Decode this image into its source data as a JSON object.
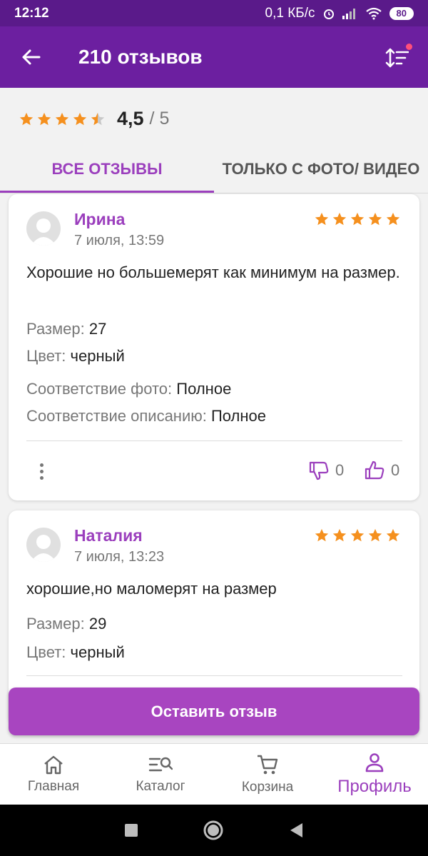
{
  "status_bar": {
    "time": "12:12",
    "network": "0,1 КБ/с",
    "battery": "80"
  },
  "app_bar": {
    "title": "210 отзывов"
  },
  "summary": {
    "rating": "4,5",
    "separator": "/ 5",
    "stars_value": 4.5
  },
  "tabs": [
    {
      "label": "ВСЕ ОТЗЫВЫ"
    },
    {
      "label": "ТОЛЬКО С ФОТО/ ВИДЕО"
    }
  ],
  "reviews": [
    {
      "author": "Ирина",
      "date": "7 июля, 13:59",
      "stars": 5,
      "text": "Хорошие но большемерят как минимум на размер.",
      "size_label": "Размер:",
      "size_value": "27",
      "color_label": "Цвет:",
      "color_value": "черный",
      "photo_label": "Соответствие фото:",
      "photo_value": "Полное",
      "desc_label": "Соответствие описанию:",
      "desc_value": "Полное",
      "dislikes": "0",
      "likes": "0"
    },
    {
      "author": "Наталия",
      "date": "7 июля, 13:23",
      "stars": 5,
      "text": "хорошие,но маломерят на размер",
      "size_label": "Размер:",
      "size_value": "29",
      "color_label": "Цвет:",
      "color_value": "черный"
    }
  ],
  "leave_review": "Оставить отзыв",
  "bottom_nav": [
    {
      "label": "Главная",
      "icon": "home-icon"
    },
    {
      "label": "Каталог",
      "icon": "catalog-search-icon"
    },
    {
      "label": "Корзина",
      "icon": "cart-icon"
    },
    {
      "label": "Профиль",
      "icon": "profile-icon",
      "active": true
    }
  ],
  "colors": {
    "accent": "#9b3fbd",
    "app_bar": "#6c1fa0",
    "star": "#f5901e",
    "button": "#a845c0"
  }
}
